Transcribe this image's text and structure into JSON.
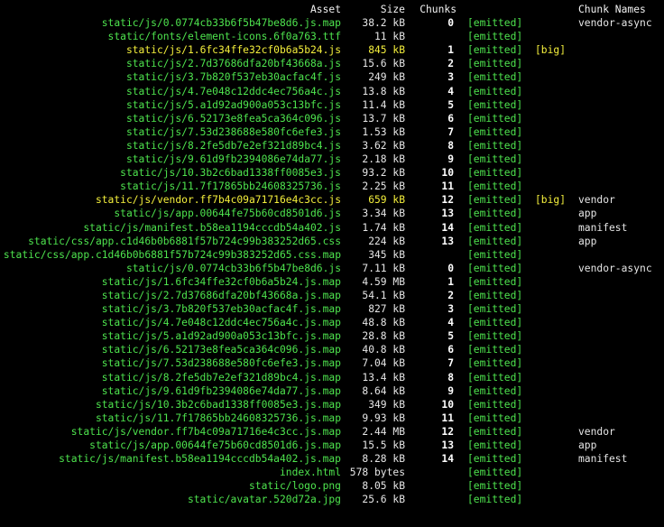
{
  "header": {
    "asset": "Asset",
    "size": "Size",
    "chunks": "Chunks",
    "chunk_names": "Chunk Names"
  },
  "colors": {
    "background": "#000000",
    "asset_green": "#4ee44e",
    "big_yellow": "#f5f03c",
    "text": "#e6e6e6"
  },
  "rows": [
    {
      "asset": "static/js/0.0774cb33b6f5b47be8d6.js.map",
      "size": "38.2 kB",
      "chunk": "0",
      "emitted": "[emitted]",
      "flag": "",
      "name": "vendor-async"
    },
    {
      "asset": "static/fonts/element-icons.6f0a763.ttf",
      "size": "11 kB",
      "chunk": "",
      "emitted": "[emitted]",
      "flag": "",
      "name": ""
    },
    {
      "asset": "static/js/1.6fc34ffe32cf0b6a5b24.js",
      "size": "845 kB",
      "chunk": "1",
      "emitted": "[emitted]",
      "flag": "[big]",
      "name": ""
    },
    {
      "asset": "static/js/2.7d37686dfa20bf43668a.js",
      "size": "15.6 kB",
      "chunk": "2",
      "emitted": "[emitted]",
      "flag": "",
      "name": ""
    },
    {
      "asset": "static/js/3.7b820f537eb30acfac4f.js",
      "size": "249 kB",
      "chunk": "3",
      "emitted": "[emitted]",
      "flag": "",
      "name": ""
    },
    {
      "asset": "static/js/4.7e048c12ddc4ec756a4c.js",
      "size": "13.8 kB",
      "chunk": "4",
      "emitted": "[emitted]",
      "flag": "",
      "name": ""
    },
    {
      "asset": "static/js/5.a1d92ad900a053c13bfc.js",
      "size": "11.4 kB",
      "chunk": "5",
      "emitted": "[emitted]",
      "flag": "",
      "name": ""
    },
    {
      "asset": "static/js/6.52173e8fea5ca364c096.js",
      "size": "13.7 kB",
      "chunk": "6",
      "emitted": "[emitted]",
      "flag": "",
      "name": ""
    },
    {
      "asset": "static/js/7.53d238688e580fc6efe3.js",
      "size": "1.53 kB",
      "chunk": "7",
      "emitted": "[emitted]",
      "flag": "",
      "name": ""
    },
    {
      "asset": "static/js/8.2fe5db7e2ef321d89bc4.js",
      "size": "3.62 kB",
      "chunk": "8",
      "emitted": "[emitted]",
      "flag": "",
      "name": ""
    },
    {
      "asset": "static/js/9.61d9fb2394086e74da77.js",
      "size": "2.18 kB",
      "chunk": "9",
      "emitted": "[emitted]",
      "flag": "",
      "name": ""
    },
    {
      "asset": "static/js/10.3b2c6bad1338ff0085e3.js",
      "size": "93.2 kB",
      "chunk": "10",
      "emitted": "[emitted]",
      "flag": "",
      "name": ""
    },
    {
      "asset": "static/js/11.7f17865bb24608325736.js",
      "size": "2.25 kB",
      "chunk": "11",
      "emitted": "[emitted]",
      "flag": "",
      "name": ""
    },
    {
      "asset": "static/js/vendor.ff7b4c09a71716e4c3cc.js",
      "size": "659 kB",
      "chunk": "12",
      "emitted": "[emitted]",
      "flag": "[big]",
      "name": "vendor"
    },
    {
      "asset": "static/js/app.00644fe75b60cd8501d6.js",
      "size": "3.34 kB",
      "chunk": "13",
      "emitted": "[emitted]",
      "flag": "",
      "name": "app"
    },
    {
      "asset": "static/js/manifest.b58ea1194cccdb54a402.js",
      "size": "1.74 kB",
      "chunk": "14",
      "emitted": "[emitted]",
      "flag": "",
      "name": "manifest"
    },
    {
      "asset": "static/css/app.c1d46b0b6881f57b724c99b383252d65.css",
      "size": "224 kB",
      "chunk": "13",
      "emitted": "[emitted]",
      "flag": "",
      "name": "app"
    },
    {
      "asset": "static/css/app.c1d46b0b6881f57b724c99b383252d65.css.map",
      "size": "345 kB",
      "chunk": "",
      "emitted": "[emitted]",
      "flag": "",
      "name": ""
    },
    {
      "asset": "static/js/0.0774cb33b6f5b47be8d6.js",
      "size": "7.11 kB",
      "chunk": "0",
      "emitted": "[emitted]",
      "flag": "",
      "name": "vendor-async"
    },
    {
      "asset": "static/js/1.6fc34ffe32cf0b6a5b24.js.map",
      "size": "4.59 MB",
      "chunk": "1",
      "emitted": "[emitted]",
      "flag": "",
      "name": ""
    },
    {
      "asset": "static/js/2.7d37686dfa20bf43668a.js.map",
      "size": "54.1 kB",
      "chunk": "2",
      "emitted": "[emitted]",
      "flag": "",
      "name": ""
    },
    {
      "asset": "static/js/3.7b820f537eb30acfac4f.js.map",
      "size": "827 kB",
      "chunk": "3",
      "emitted": "[emitted]",
      "flag": "",
      "name": ""
    },
    {
      "asset": "static/js/4.7e048c12ddc4ec756a4c.js.map",
      "size": "48.8 kB",
      "chunk": "4",
      "emitted": "[emitted]",
      "flag": "",
      "name": ""
    },
    {
      "asset": "static/js/5.a1d92ad900a053c13bfc.js.map",
      "size": "28.8 kB",
      "chunk": "5",
      "emitted": "[emitted]",
      "flag": "",
      "name": ""
    },
    {
      "asset": "static/js/6.52173e8fea5ca364c096.js.map",
      "size": "40.8 kB",
      "chunk": "6",
      "emitted": "[emitted]",
      "flag": "",
      "name": ""
    },
    {
      "asset": "static/js/7.53d238688e580fc6efe3.js.map",
      "size": "7.04 kB",
      "chunk": "7",
      "emitted": "[emitted]",
      "flag": "",
      "name": ""
    },
    {
      "asset": "static/js/8.2fe5db7e2ef321d89bc4.js.map",
      "size": "13.4 kB",
      "chunk": "8",
      "emitted": "[emitted]",
      "flag": "",
      "name": ""
    },
    {
      "asset": "static/js/9.61d9fb2394086e74da77.js.map",
      "size": "8.64 kB",
      "chunk": "9",
      "emitted": "[emitted]",
      "flag": "",
      "name": ""
    },
    {
      "asset": "static/js/10.3b2c6bad1338ff0085e3.js.map",
      "size": "349 kB",
      "chunk": "10",
      "emitted": "[emitted]",
      "flag": "",
      "name": ""
    },
    {
      "asset": "static/js/11.7f17865bb24608325736.js.map",
      "size": "9.93 kB",
      "chunk": "11",
      "emitted": "[emitted]",
      "flag": "",
      "name": ""
    },
    {
      "asset": "static/js/vendor.ff7b4c09a71716e4c3cc.js.map",
      "size": "2.44 MB",
      "chunk": "12",
      "emitted": "[emitted]",
      "flag": "",
      "name": "vendor"
    },
    {
      "asset": "static/js/app.00644fe75b60cd8501d6.js.map",
      "size": "15.5 kB",
      "chunk": "13",
      "emitted": "[emitted]",
      "flag": "",
      "name": "app"
    },
    {
      "asset": "static/js/manifest.b58ea1194cccdb54a402.js.map",
      "size": "8.28 kB",
      "chunk": "14",
      "emitted": "[emitted]",
      "flag": "",
      "name": "manifest"
    },
    {
      "asset": "index.html",
      "size": "578 bytes",
      "chunk": "",
      "emitted": "[emitted]",
      "flag": "",
      "name": ""
    },
    {
      "asset": "static/logo.png",
      "size": "8.05 kB",
      "chunk": "",
      "emitted": "[emitted]",
      "flag": "",
      "name": ""
    },
    {
      "asset": "static/avatar.520d72a.jpg",
      "size": "25.6 kB",
      "chunk": "",
      "emitted": "[emitted]",
      "flag": "",
      "name": ""
    }
  ]
}
